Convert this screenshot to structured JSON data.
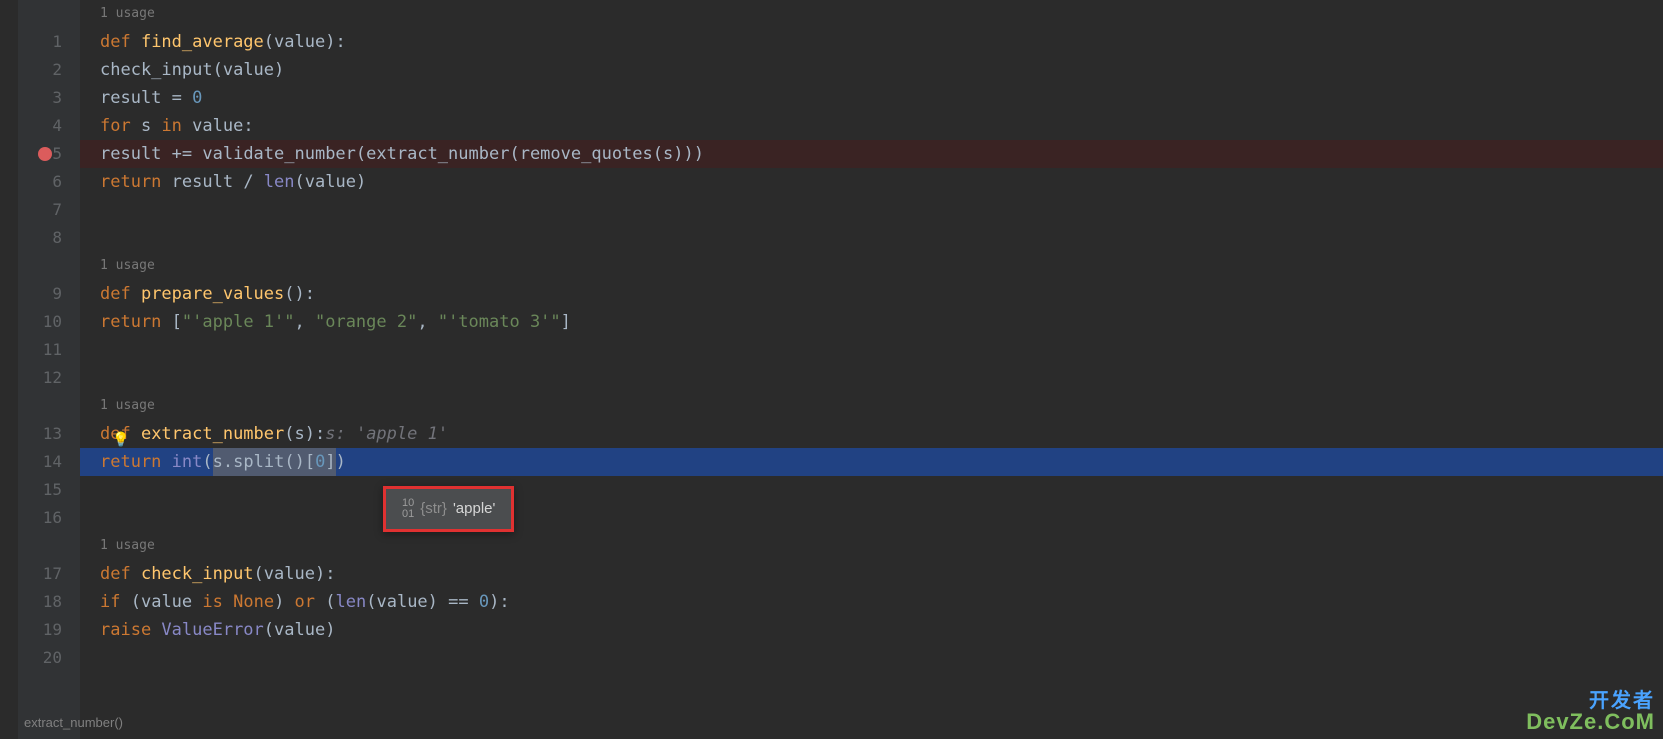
{
  "usage_label": "1 usage",
  "lines": {
    "l1": {
      "num": "1"
    },
    "l2": {
      "num": "2"
    },
    "l3": {
      "num": "3"
    },
    "l4": {
      "num": "4"
    },
    "l5": {
      "num": "5"
    },
    "l6": {
      "num": "6"
    },
    "l7": {
      "num": "7"
    },
    "l8": {
      "num": "8"
    },
    "l9": {
      "num": "9"
    },
    "l10": {
      "num": "10"
    },
    "l11": {
      "num": "11"
    },
    "l12": {
      "num": "12"
    },
    "l13": {
      "num": "13"
    },
    "l14": {
      "num": "14"
    },
    "l15": {
      "num": "15"
    },
    "l16": {
      "num": "16"
    },
    "l17": {
      "num": "17"
    },
    "l18": {
      "num": "18"
    },
    "l19": {
      "num": "19"
    },
    "l20": {
      "num": "20"
    }
  },
  "code": {
    "def": "def ",
    "return": "return ",
    "for": "for ",
    "in": " in ",
    "if": "if ",
    "is": " is ",
    "or": " or ",
    "raise": "raise ",
    "find_average": "find_average",
    "prepare_values": "prepare_values",
    "extract_number": "extract_number",
    "check_input": "check_input",
    "validate_number": "validate_number",
    "remove_quotes": "remove_quotes",
    "value": "value",
    "result": "result",
    "s": "s",
    "int": "int",
    "len": "len",
    "split": "split",
    "None": "None",
    "ValueError": "ValueError",
    "zero": "0",
    "zero2": "0",
    "colon": ":",
    "eq": " = ",
    "pluseq": " += ",
    "div": " / ",
    "eqeq": " == ",
    "lp": "(",
    "rp": ")",
    "lb": "[",
    "rb": "]",
    "dot": ".",
    "comma": ", ",
    "str1": "\"'apple 1'\"",
    "str2": "\"orange 2\"",
    "str3": "\"'tomato 3'\"",
    "param_hint": "s: 'apple 1'"
  },
  "tooltip": {
    "bin": "10\n01",
    "type": "{str}",
    "value": "'apple'"
  },
  "breadcrumb": "extract_number()",
  "watermark": {
    "line1": "开发者",
    "line2": "DevZe.CoM"
  }
}
